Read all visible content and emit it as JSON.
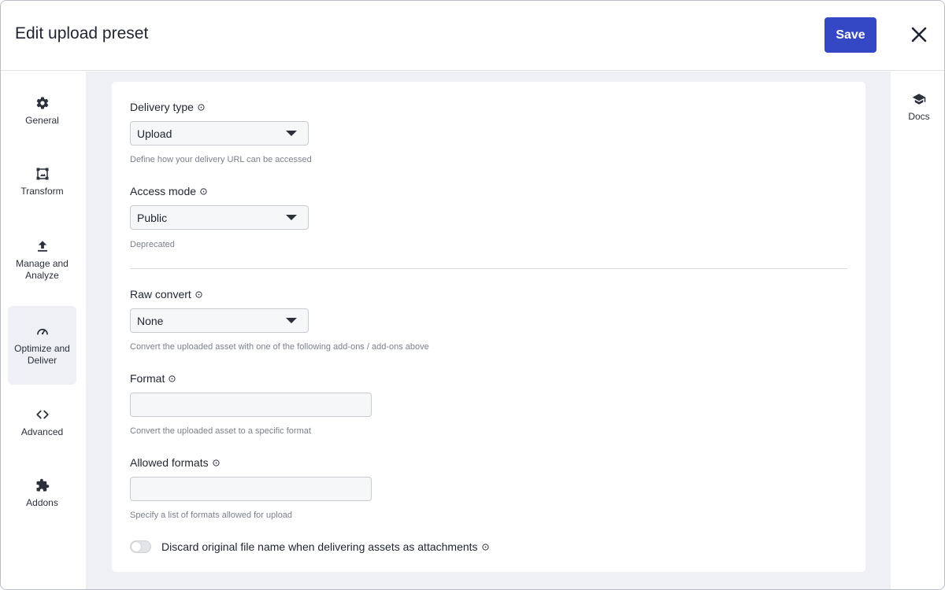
{
  "header": {
    "title": "Edit upload preset",
    "save_label": "Save"
  },
  "sidebar": {
    "items": [
      {
        "label": "General",
        "icon": "gear-icon"
      },
      {
        "label": "Transform",
        "icon": "crop-frame-icon"
      },
      {
        "label": "Manage and Analyze",
        "icon": "upload-arrow-icon"
      },
      {
        "label": "Optimize and Deliver",
        "icon": "speedometer-icon",
        "active": true
      },
      {
        "label": "Advanced",
        "icon": "code-brackets-icon"
      },
      {
        "label": "Addons",
        "icon": "puzzle-piece-icon"
      }
    ]
  },
  "right_panel": {
    "docs_label": "Docs",
    "docs_icon": "graduation-cap-icon"
  },
  "form": {
    "delivery_type": {
      "label": "Delivery type",
      "value": "Upload",
      "hint": "Define how your delivery URL can be accessed"
    },
    "access_mode": {
      "label": "Access mode",
      "value": "Public",
      "hint": "Deprecated"
    },
    "raw_convert": {
      "label": "Raw convert",
      "value": "None",
      "hint": "Convert the uploaded asset with one of the following add-ons / add-ons above"
    },
    "format": {
      "label": "Format",
      "value": "",
      "hint": "Convert the uploaded asset to a specific format"
    },
    "allowed_formats": {
      "label": "Allowed formats",
      "value": "",
      "hint": "Specify a list of formats allowed for upload"
    },
    "discard_filename": {
      "label": "Discard original file name when delivering assets as attachments",
      "enabled": false
    }
  },
  "colors": {
    "accent": "#3448c5",
    "content_background": "#eef0f5",
    "active_nav": "#eef0f6"
  }
}
